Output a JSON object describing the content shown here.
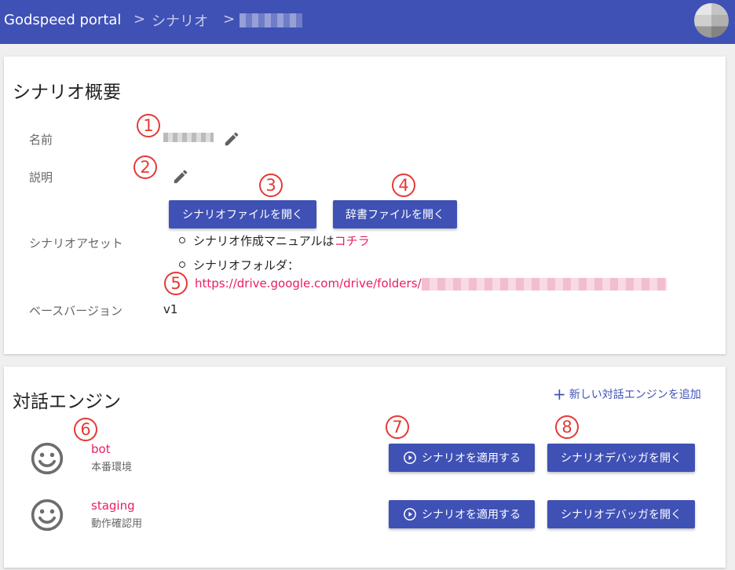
{
  "header": {
    "brand": "Godspeed portal",
    "breadcrumb_separator": ">",
    "breadcrumb_scenario": "シナリオ",
    "bg_color": "#3f51b5"
  },
  "overview": {
    "title": "シナリオ概要",
    "name_label": "名前",
    "description_label": "説明",
    "assets_label": "シナリオアセット",
    "base_version_label": "ベースバージョン",
    "base_version_value": "v1",
    "open_scenario_file_button": "シナリオファイルを開く",
    "open_dictionary_file_button": "辞書ファイルを開く",
    "manual_text": "シナリオ作成マニュアルは",
    "manual_link": "コチラ",
    "folder_text": "シナリオフォルダ：",
    "folder_url": "https://drive.google.com/drive/folders/"
  },
  "engines": {
    "title": "対話エンジン",
    "add_button": "新しい対話エンジンを追加",
    "apply_label": "シナリオを適用する",
    "debugger_label": "シナリオデバッガを開く",
    "items": [
      {
        "name": "bot",
        "description": "本番環境"
      },
      {
        "name": "staging",
        "description": "動作確認用"
      }
    ]
  },
  "annotations": [
    "1",
    "2",
    "3",
    "4",
    "5",
    "6",
    "7",
    "8"
  ],
  "colors": {
    "accent": "#3f51b5",
    "link": "#e91e63",
    "annotation": "#e53935"
  }
}
